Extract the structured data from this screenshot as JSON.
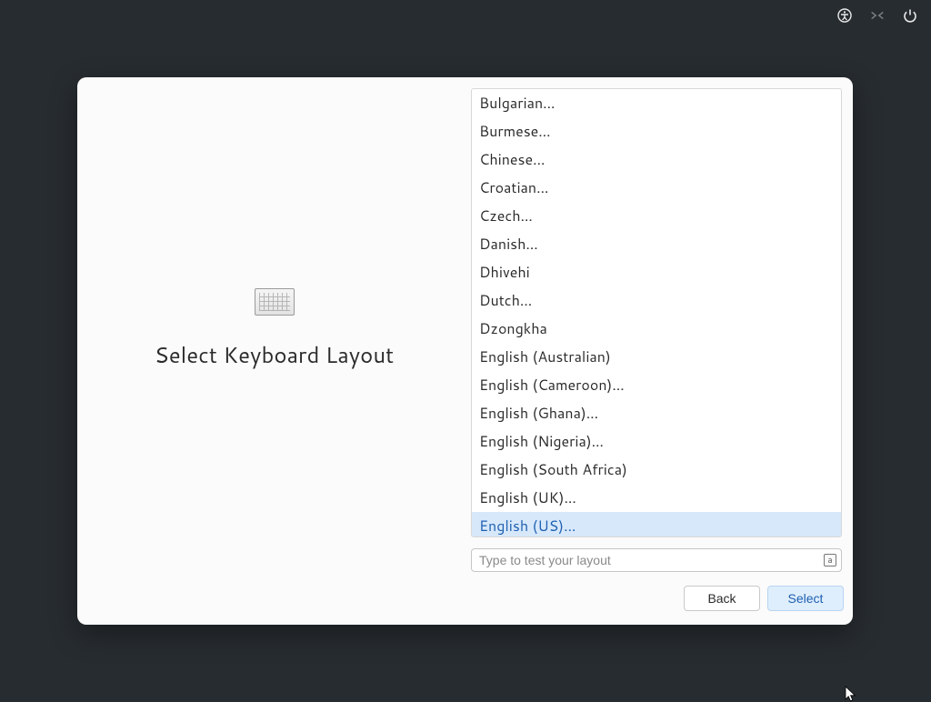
{
  "topbar": {
    "icons": [
      "accessibility-icon",
      "network-disconnected-icon",
      "power-icon"
    ]
  },
  "page": {
    "title": "Select Keyboard Layout"
  },
  "layout_list": {
    "items": [
      "Bulgarian…",
      "Burmese…",
      "Chinese…",
      "Croatian…",
      "Czech…",
      "Danish…",
      "Dhivehi",
      "Dutch…",
      "Dzongkha",
      "English (Australian)",
      "English (Cameroon)…",
      "English (Ghana)…",
      "English (Nigeria)…",
      "English (South Africa)",
      "English (UK)…",
      "English (US)…"
    ],
    "selected_index": 15
  },
  "test_input": {
    "placeholder": "Type to test your layout",
    "indicator": "a"
  },
  "buttons": {
    "back": "Back",
    "select": "Select"
  }
}
